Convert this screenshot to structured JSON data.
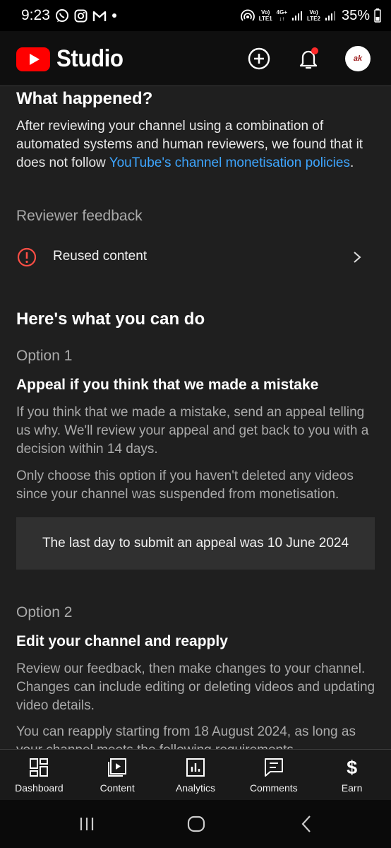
{
  "status_bar": {
    "time": "9:23",
    "net1_label_top": "Vo)",
    "net1_label_bottom": "LTE1",
    "net_type": "4G+",
    "net2_label_top": "Vo)",
    "net2_label_bottom": "LTE2",
    "battery": "35%"
  },
  "header": {
    "app_name": "Studio",
    "avatar_text": "ak",
    "brand_color": "#ff0000"
  },
  "content": {
    "what_happened_title": "What happened?",
    "what_happened_text": "After reviewing your channel using a combination of automated systems and human reviewers, we found that it does not follow ",
    "policy_link": "YouTube's channel monetisation policies",
    "period": ".",
    "reviewer_feedback_label": "Reviewer feedback",
    "feedback_item": "Reused content",
    "what_you_can_do_title": "Here's what you can do",
    "option1": {
      "label": "Option 1",
      "title": "Appeal if you think that we made a mistake",
      "text1": "If you think that we made a mistake, send an appeal telling us why. We'll review your appeal and get back to you with a decision within 14 days.",
      "text2": "Only choose this option if you haven't deleted any videos since your channel was suspended from monetisation.",
      "notice": "The last day to submit an appeal was 10 June 2024"
    },
    "option2": {
      "label": "Option 2",
      "title": "Edit your channel and reapply",
      "text1": "Review our feedback, then make changes to your channel. Changes can include editing or deleting videos and updating video details.",
      "text2": "You can reapply starting from 18 August 2024, as long as your channel meets the following requirements."
    }
  },
  "bottom_nav": {
    "items": [
      {
        "label": "Dashboard",
        "icon": "dashboard-icon"
      },
      {
        "label": "Content",
        "icon": "content-icon"
      },
      {
        "label": "Analytics",
        "icon": "analytics-icon"
      },
      {
        "label": "Comments",
        "icon": "comments-icon"
      },
      {
        "label": "Earn",
        "icon": "earn-icon"
      }
    ]
  }
}
